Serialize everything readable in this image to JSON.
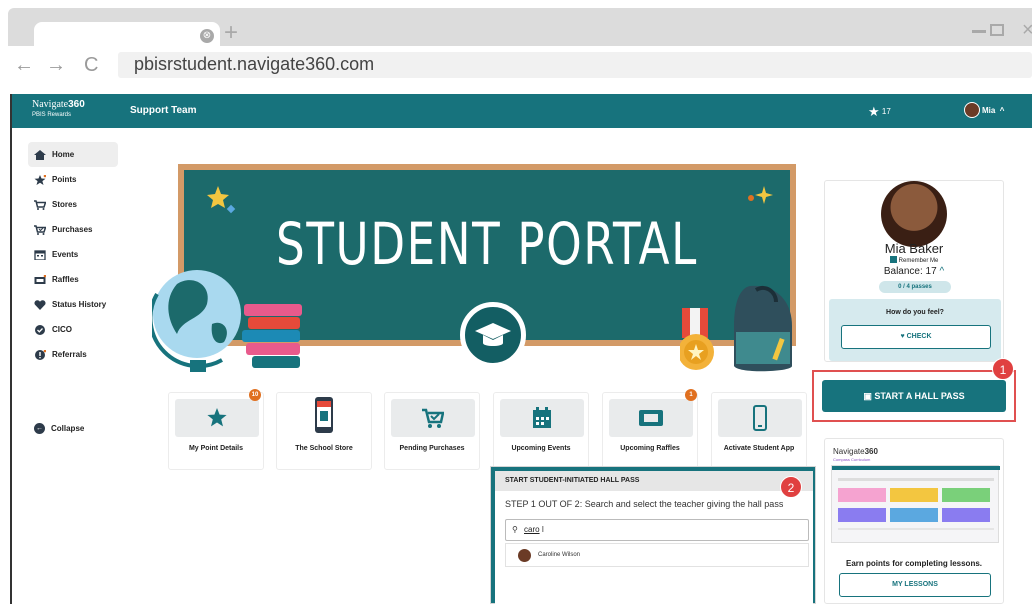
{
  "browser": {
    "url": "pbisrstudent.navigate360.com",
    "back_icon": "←",
    "forward_icon": "→",
    "reload_icon": "C",
    "tab_close_icon": "⊗",
    "new_tab_icon": "+"
  },
  "topbar": {
    "logo_main": "Navigate",
    "logo_bold": "360",
    "logo_sub": "PBIS Rewards",
    "team": "Support Team",
    "star_count": "17",
    "user_name": "Mia"
  },
  "sidebar": {
    "items": [
      {
        "label": "Home",
        "icon": "home-icon"
      },
      {
        "label": "Points",
        "icon": "star-icon"
      },
      {
        "label": "Stores",
        "icon": "cart-icon"
      },
      {
        "label": "Purchases",
        "icon": "cart-check-icon"
      },
      {
        "label": "Events",
        "icon": "calendar-icon"
      },
      {
        "label": "Raffles",
        "icon": "ticket-icon"
      },
      {
        "label": "Status History",
        "icon": "heart-icon"
      },
      {
        "label": "CICO",
        "icon": "check-circle-icon"
      },
      {
        "label": "Referrals",
        "icon": "alert-icon"
      }
    ],
    "collapse": "Collapse"
  },
  "banner": {
    "title": "STUDENT PORTAL"
  },
  "tiles": [
    {
      "label": "My Point Details",
      "badge": "10",
      "icon": "star-icon"
    },
    {
      "label": "The School Store",
      "badge": "",
      "icon": "store-icon"
    },
    {
      "label": "Pending Purchases",
      "badge": "",
      "icon": "cart-check-icon"
    },
    {
      "label": "Upcoming Events",
      "badge": "",
      "icon": "calendar-icon"
    },
    {
      "label": "Upcoming Raffles",
      "badge": "1",
      "icon": "ticket-icon"
    },
    {
      "label": "Activate Student App",
      "badge": "",
      "icon": "phone-icon"
    }
  ],
  "profile": {
    "name": "Mia Baker",
    "remember": "Remember Me",
    "balance": "Balance: 17",
    "passes": "0 / 4 passes",
    "feel": "How do you feel?",
    "check": "CHECK"
  },
  "hallpass": {
    "label": "START A HALL PASS",
    "step": "1"
  },
  "lessons": {
    "brand": "Navigate",
    "brand_bold": "360",
    "subtitle": "Compass Curriculum",
    "text": "Earn points for completing lessons.",
    "button": "MY LESSONS"
  },
  "modal": {
    "title": "START STUDENT-INITIATED HALL PASS",
    "step_badge": "2",
    "step": "STEP 1 OUT OF 2: Search and select the teacher giving the hall pass",
    "search_value": "caro",
    "result": "Caroline Wilson"
  },
  "colors": {
    "brand": "#17737d",
    "badge": "#e07020",
    "highlight": "#e05050"
  }
}
